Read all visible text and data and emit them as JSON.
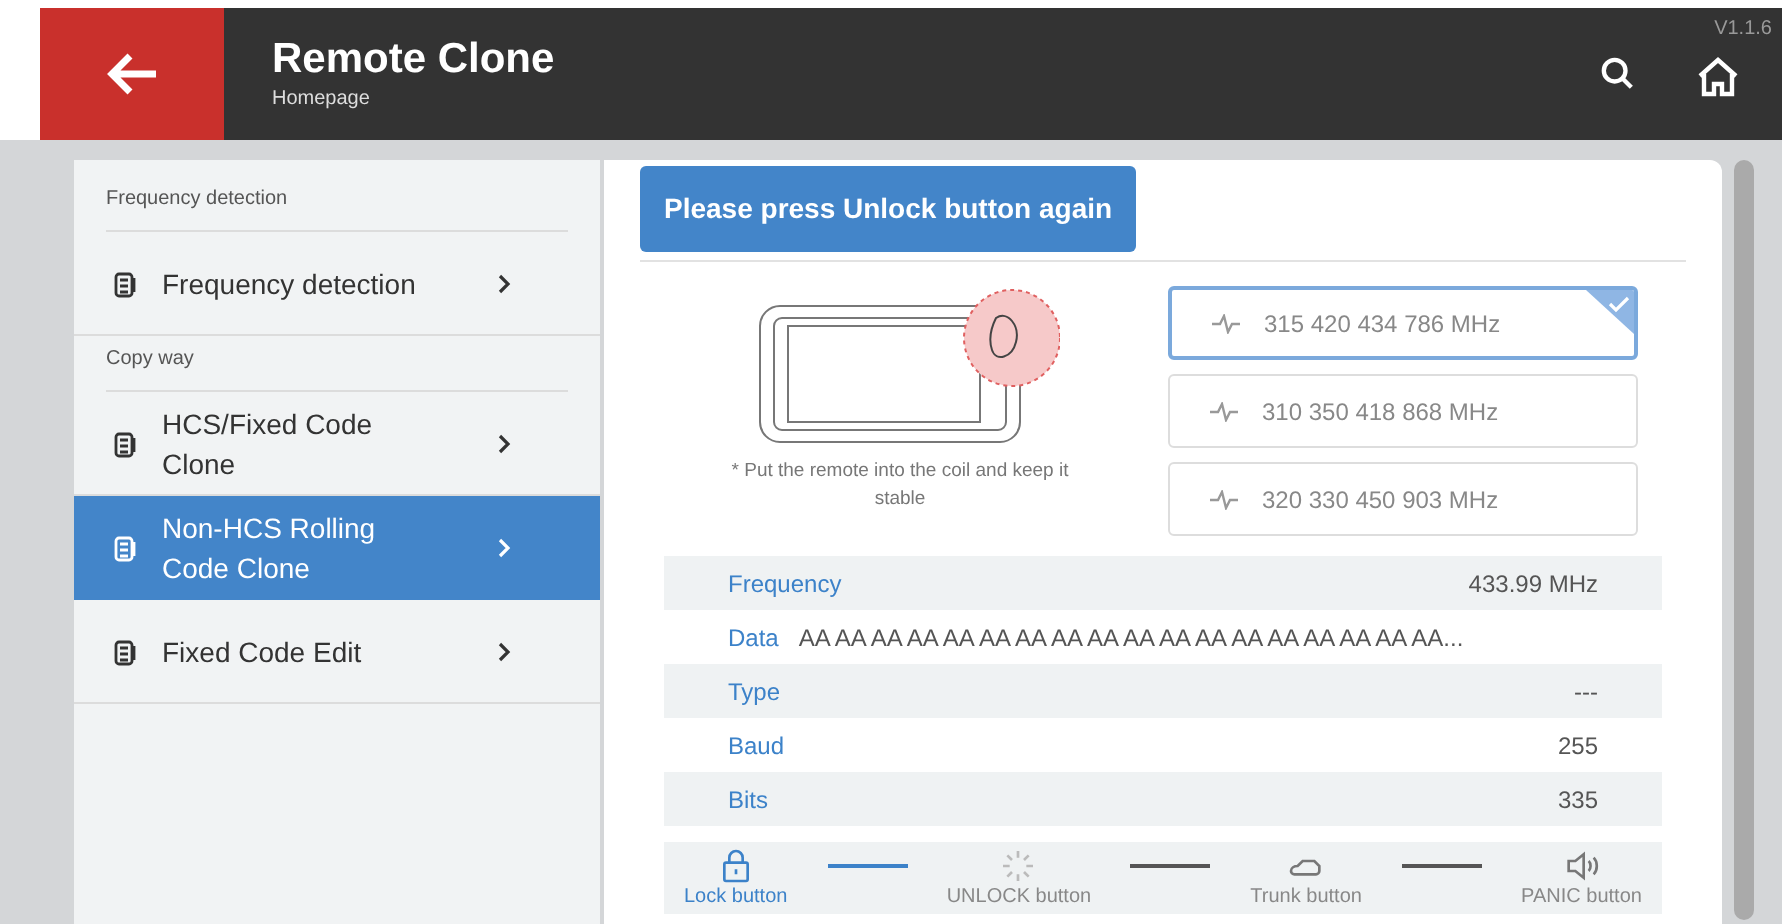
{
  "header": {
    "title": "Remote Clone",
    "subtitle": "Homepage",
    "version": "V1.1.6"
  },
  "sidebar": {
    "sections": [
      {
        "heading": "Frequency detection",
        "items": [
          {
            "label": "Frequency detection",
            "selected": false
          }
        ]
      },
      {
        "heading": "Copy way",
        "items": [
          {
            "label": "HCS/Fixed Code Clone",
            "selected": false
          },
          {
            "label": "Non-HCS Rolling Code Clone",
            "selected": true
          },
          {
            "label": "Fixed Code Edit",
            "selected": false
          }
        ]
      }
    ]
  },
  "prompt": "Please press Unlock button again",
  "hint": "* Put the remote into the coil and keep it stable",
  "frequency_options": [
    {
      "label": "315 420 434 786 MHz",
      "selected": true
    },
    {
      "label": "310 350 418 868 MHz",
      "selected": false
    },
    {
      "label": "320 330 450 903 MHz",
      "selected": false
    }
  ],
  "details": [
    {
      "label": "Frequency",
      "value": "433.99 MHz",
      "kind": "right"
    },
    {
      "label": "Data",
      "value": "AA AA AA AA AA AA AA AA AA AA AA AA AA AA AA AA AA AA...",
      "kind": "inline"
    },
    {
      "label": "Type",
      "value": "---",
      "kind": "right"
    },
    {
      "label": "Baud",
      "value": "255",
      "kind": "right"
    },
    {
      "label": "Bits",
      "value": "335",
      "kind": "right"
    }
  ],
  "steps": [
    {
      "kind": "lock",
      "label": "Lock button",
      "done": true,
      "active": false
    },
    {
      "kind": "unlock",
      "label": "UNLOCK button",
      "done": false,
      "active": true
    },
    {
      "kind": "trunk",
      "label": "Trunk button",
      "done": false,
      "active": false
    },
    {
      "kind": "panic",
      "label": "PANIC button",
      "done": false,
      "active": false
    }
  ]
}
